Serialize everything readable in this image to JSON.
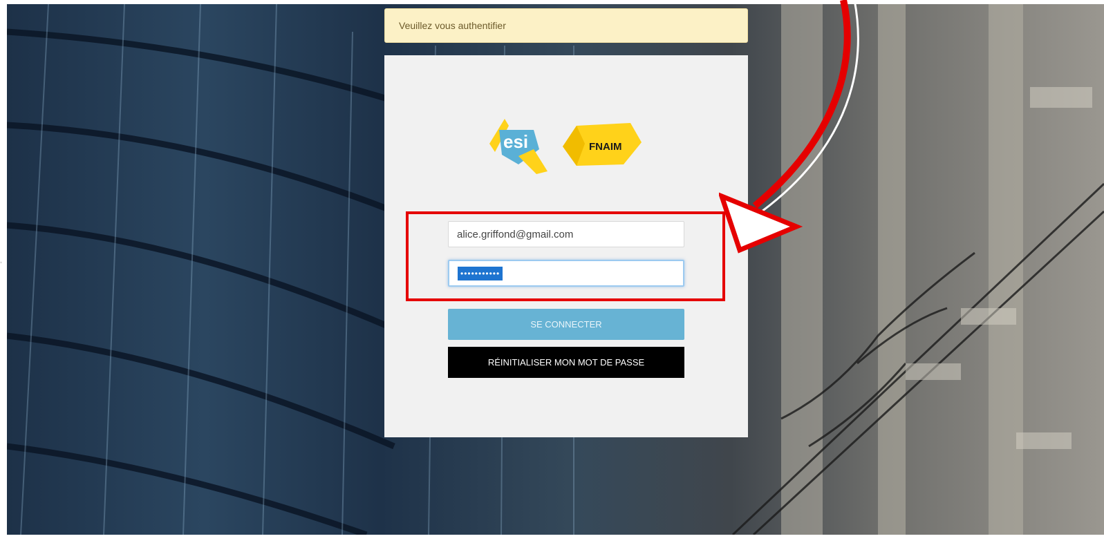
{
  "alert": {
    "message": "Veuillez vous authentifier"
  },
  "logos": {
    "esi_text": "esi",
    "fnaim_text": "FNAIM"
  },
  "form": {
    "email_value": "alice.griffond@gmail.com",
    "password_masked": "•••••••••••",
    "login_label": "SE CONNECTER",
    "reset_label": "RÉINITIALISER MON MOT DE PASSE"
  },
  "colors": {
    "alert_bg": "#fcf1c6",
    "login_button": "#67b3d4",
    "reset_button": "#000000",
    "annotation_red": "#e50000",
    "logo_yellow": "#ffd21a",
    "logo_teal": "#5ab0d6"
  }
}
